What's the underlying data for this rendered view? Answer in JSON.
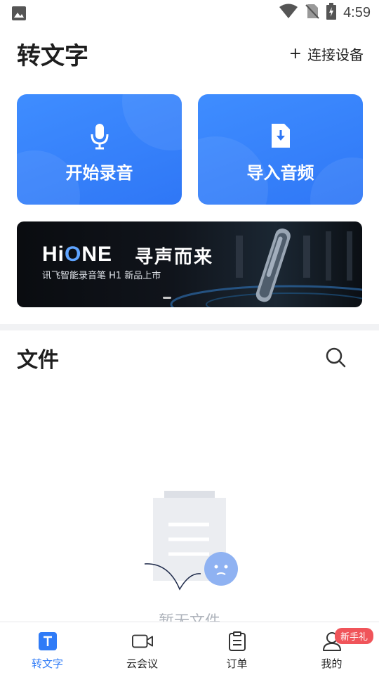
{
  "status_bar": {
    "time": "4:59"
  },
  "header": {
    "title": "转文字",
    "connect_icon": "+",
    "connect_label": "连接设备"
  },
  "actions": {
    "record_label": "开始录音",
    "import_label": "导入音频",
    "color": "#3483fb"
  },
  "banner": {
    "brand_prefix": "Hi",
    "brand_o": "O",
    "brand_suffix": "NE",
    "headline": "寻声而来",
    "subline": "讯飞智能录音笔 H1 新品上市"
  },
  "files": {
    "title": "文件",
    "empty_text": "暂无文件"
  },
  "bottom_nav": {
    "items": [
      {
        "label": "转文字",
        "icon": "text-t-icon",
        "active": true
      },
      {
        "label": "云会议",
        "icon": "video-camera-icon"
      },
      {
        "label": "订单",
        "icon": "order-list-icon"
      },
      {
        "label": "我的",
        "icon": "user-profile-icon",
        "badge": "新手礼"
      }
    ],
    "active_color": "#2f7bf7",
    "badge_color": "#f0545a"
  }
}
